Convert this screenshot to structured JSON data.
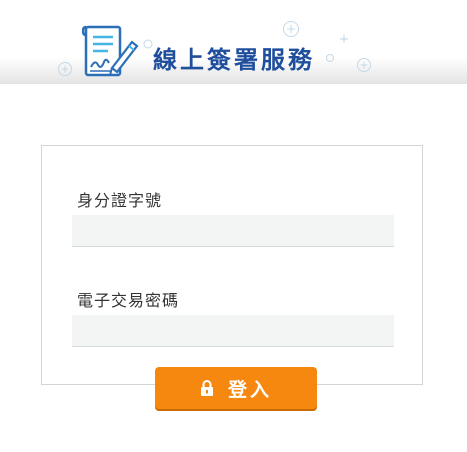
{
  "header": {
    "title": "線上簽署服務",
    "brand_color": "#1f4f9c"
  },
  "form": {
    "id_label": "身分證字號",
    "id_value": "",
    "password_label": "電子交易密碼",
    "password_value": ""
  },
  "login": {
    "label": "登入",
    "icon": "lock-icon",
    "color": "#f7880f"
  }
}
